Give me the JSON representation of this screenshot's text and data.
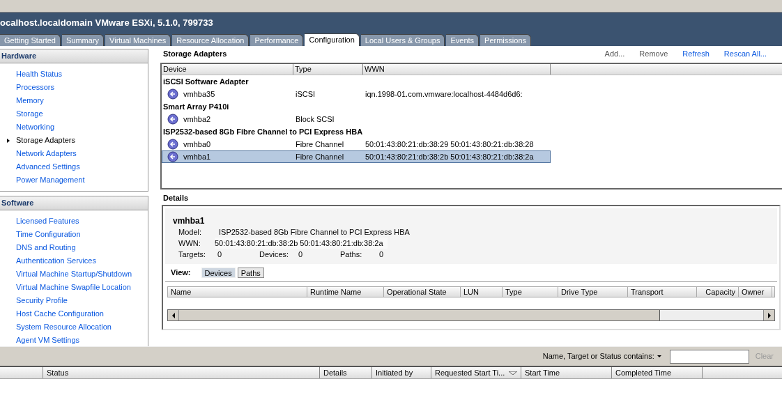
{
  "window": {
    "title": "ocalhost.localdomain VMware ESXi, 5.1.0, 799733"
  },
  "tabs": [
    {
      "label": "Getting Started",
      "selected": false
    },
    {
      "label": "Summary",
      "selected": false
    },
    {
      "label": "Virtual Machines",
      "selected": false
    },
    {
      "label": "Resource Allocation",
      "selected": false
    },
    {
      "label": "Performance",
      "selected": false
    },
    {
      "label": "Configuration",
      "selected": true
    },
    {
      "label": "Local Users & Groups",
      "selected": false
    },
    {
      "label": "Events",
      "selected": false
    },
    {
      "label": "Permissions",
      "selected": false
    }
  ],
  "sidebar": [
    {
      "title": "Hardware",
      "items": [
        {
          "label": "Health Status",
          "selected": false
        },
        {
          "label": "Processors",
          "selected": false
        },
        {
          "label": "Memory",
          "selected": false
        },
        {
          "label": "Storage",
          "selected": false
        },
        {
          "label": "Networking",
          "selected": false
        },
        {
          "label": "Storage Adapters",
          "selected": true
        },
        {
          "label": "Network Adapters",
          "selected": false
        },
        {
          "label": "Advanced Settings",
          "selected": false
        },
        {
          "label": "Power Management",
          "selected": false
        }
      ]
    },
    {
      "title": "Software",
      "items": [
        {
          "label": "Licensed Features",
          "selected": false
        },
        {
          "label": "Time Configuration",
          "selected": false
        },
        {
          "label": "DNS and Routing",
          "selected": false
        },
        {
          "label": "Authentication Services",
          "selected": false
        },
        {
          "label": "Virtual Machine Startup/Shutdown",
          "selected": false
        },
        {
          "label": "Virtual Machine Swapfile Location",
          "selected": false
        },
        {
          "label": "Security Profile",
          "selected": false
        },
        {
          "label": "Host Cache Configuration",
          "selected": false
        },
        {
          "label": "System Resource Allocation",
          "selected": false
        },
        {
          "label": "Agent VM Settings",
          "selected": false
        }
      ]
    }
  ],
  "adapters": {
    "title": "Storage Adapters",
    "actions": [
      {
        "label": "Add...",
        "disabled": true
      },
      {
        "label": "Remove",
        "disabled": true
      },
      {
        "label": "Refresh",
        "disabled": false
      },
      {
        "label": "Rescan All...",
        "disabled": false
      }
    ],
    "columns": [
      "Device",
      "Type",
      "WWN"
    ],
    "rows": [
      {
        "kind": "group",
        "label": "iSCSI Software Adapter"
      },
      {
        "kind": "device",
        "device": "vmhba35",
        "type": "iSCSI",
        "wwn": "iqn.1998-01.com.vmware:localhost-4484d6d6:",
        "selected": false
      },
      {
        "kind": "group",
        "label": "Smart Array P410i"
      },
      {
        "kind": "device",
        "device": "vmhba2",
        "type": "Block SCSI",
        "selected": false
      },
      {
        "kind": "group",
        "label": "ISP2532-based 8Gb Fibre Channel to PCI Express HBA"
      },
      {
        "kind": "device",
        "device": "vmhba0",
        "type": "Fibre Channel",
        "wwn": "50:01:43:80:21:db:38:29 50:01:43:80:21:db:38:28",
        "selected": false
      },
      {
        "kind": "device",
        "device": "vmhba1",
        "type": "Fibre Channel",
        "wwn": "50:01:43:80:21:db:38:2b 50:01:43:80:21:db:38:2a",
        "selected": true
      }
    ]
  },
  "details": {
    "title": "Details",
    "name": "vmhba1",
    "model_label": "Model:",
    "model": "ISP2532-based 8Gb Fibre Channel to PCI Express HBA",
    "wwn_label": "WWN:",
    "wwn": "50:01:43:80:21:db:38:2b 50:01:43:80:21:db:38:2a",
    "counts": [
      {
        "label": "Targets:",
        "value": "0"
      },
      {
        "label": "Devices:",
        "value": "0"
      },
      {
        "label": "Paths:",
        "value": "0"
      }
    ],
    "view_label": "View:",
    "views": [
      {
        "label": "Devices",
        "selected": true
      },
      {
        "label": "Paths",
        "selected": false
      }
    ],
    "columns": [
      "Name",
      "Runtime Name",
      "Operational State",
      "LUN",
      "Type",
      "Drive Type",
      "Transport",
      "Capacity",
      "Owner"
    ]
  },
  "tasks": {
    "filter_label": "Name, Target or Status contains:",
    "clear": "Clear",
    "columns": [
      "Status",
      "Details",
      "Initiated by",
      "Requested Start Ti...",
      "Start Time",
      "Completed Time"
    ]
  }
}
